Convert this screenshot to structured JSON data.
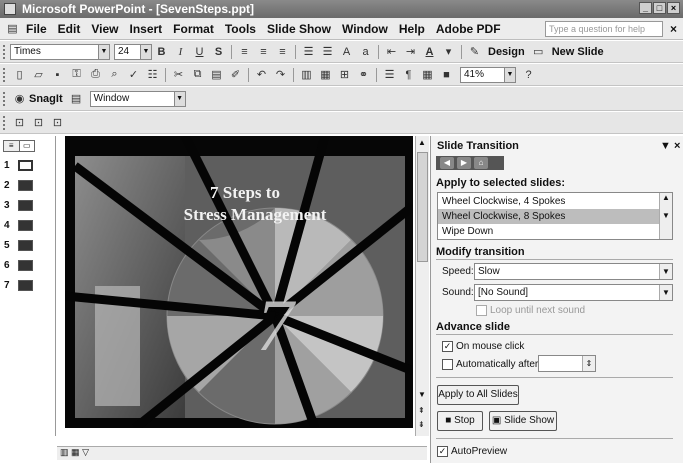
{
  "window": {
    "title": "Microsoft PowerPoint - [SevenSteps.ppt]"
  },
  "menu": {
    "items": [
      "File",
      "Edit",
      "View",
      "Insert",
      "Format",
      "Tools",
      "Slide Show",
      "Window",
      "Help",
      "Adobe PDF"
    ],
    "help_placeholder": "Type a question for help"
  },
  "formatting_toolbar": {
    "font": "Times",
    "size": "24",
    "bold": "B",
    "italic": "I",
    "underline": "U",
    "shadow": "S",
    "design_label": "Design",
    "new_slide_label": "New Slide"
  },
  "standard_toolbar": {
    "zoom": "41%"
  },
  "snagit_toolbar": {
    "snagit_label": "SnagIt",
    "mode": "Window"
  },
  "slides": [
    {
      "number": "1"
    },
    {
      "number": "2"
    },
    {
      "number": "3"
    },
    {
      "number": "4"
    },
    {
      "number": "5"
    },
    {
      "number": "6"
    },
    {
      "number": "7"
    }
  ],
  "slide": {
    "title_line1": "7 Steps to",
    "title_line2": "Stress Management",
    "big_number": "7"
  },
  "task_pane": {
    "title": "Slide Transition",
    "apply_heading": "Apply to selected slides:",
    "transitions": [
      "Wheel Clockwise, 4 Spokes",
      "Wheel Clockwise, 8 Spokes",
      "Wipe Down"
    ],
    "modify_heading": "Modify transition",
    "speed_label": "Speed:",
    "speed_value": "Slow",
    "sound_label": "Sound:",
    "sound_value": "[No Sound]",
    "loop_label": "Loop until next sound",
    "advance_heading": "Advance slide",
    "on_mouse_click_label": "On mouse click",
    "automatically_label": "Automatically after",
    "apply_all_label": "Apply to All Slides",
    "play_label": "Stop",
    "slideshow_label": "Slide Show",
    "autopreview_label": "AutoPreview"
  }
}
